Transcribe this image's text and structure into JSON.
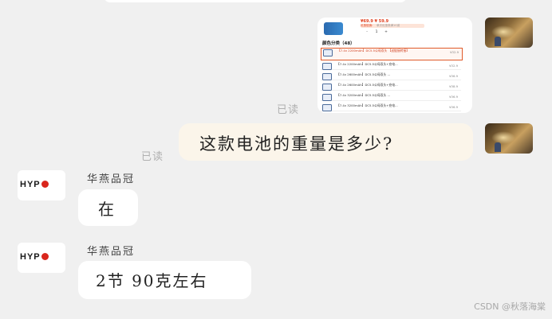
{
  "messages": {
    "screenshot": {
      "price": "¥69.9 ¥ 59.9 ",
      "promo_label": "优惠促销:",
      "promo_note": "单次优惠券满10减",
      "stepper": {
        "minus": "-",
        "qty": "1",
        "plus": "+"
      },
      "section_title": "颜色分类（48）",
      "rows": [
        {
          "text": "【7.4v 2200mAh】DC5.5公母双头  【送链接转接】",
          "price": "¥32.9",
          "selected": true
        },
        {
          "text": "【7.4v 2200mAh】DC5.5公母双头+充电...",
          "price": "¥32.9"
        },
        {
          "text": "【7.4v 2600mAh】DC5.5公母双头 ...",
          "price": "¥36.9"
        },
        {
          "text": "【7.4v 2600mAh】DC5.5公母双头+充电...",
          "price": "¥38.9"
        },
        {
          "text": "【7.4v 3200mAh】DC5.5公母双头 ...",
          "price": "¥36.9"
        },
        {
          "text": "【7.4v 3200mAh】DC5.5公母双头+充电...",
          "price": "¥36.9"
        }
      ]
    },
    "read_label_1": "已读",
    "question": "这款电池的重量是多少?",
    "read_label_2": "已读",
    "reply_1": {
      "sender": "华燕品冠",
      "text": "在"
    },
    "reply_2": {
      "sender": "华燕品冠",
      "text": "2节 90克左右"
    }
  },
  "logo_text": "HYP",
  "watermark": "CSDN @秋落海棠",
  "colors": {
    "background": "#f0f0f0",
    "question_bubble": "#fbf5ea",
    "reply_bubble": "#ffffff",
    "read_label": "#b0b0b0",
    "logo_accent": "#d9261c"
  }
}
